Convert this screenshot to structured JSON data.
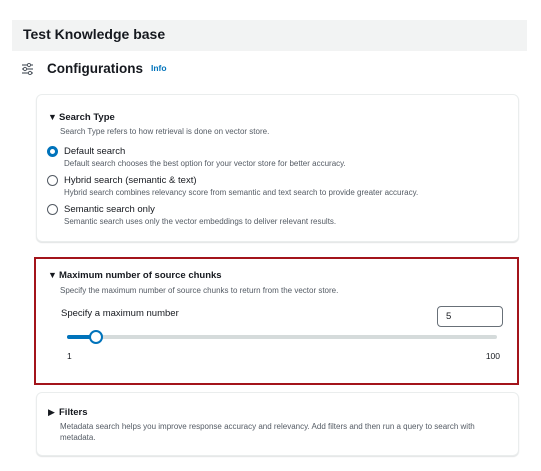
{
  "header": {
    "title": "Test Knowledge base"
  },
  "config": {
    "title": "Configurations",
    "info_label": "Info",
    "icon": "settings-sliders-icon"
  },
  "search_type": {
    "title": "Search Type",
    "description": "Search Type refers to how retrieval is done on vector store.",
    "options": [
      {
        "label": "Default search",
        "description": "Default search chooses the best option for your vector store for better accuracy.",
        "checked": true
      },
      {
        "label": "Hybrid search (semantic & text)",
        "description": "Hybrid search combines relevancy score from semantic and text search to provide greater accuracy.",
        "checked": false
      },
      {
        "label": "Semantic search only",
        "description": "Semantic search uses only the vector embeddings to deliver relevant results.",
        "checked": false
      }
    ]
  },
  "max_chunks": {
    "title": "Maximum number of source chunks",
    "description": "Specify the maximum number of source chunks to return from the vector store.",
    "field_label": "Specify a maximum number",
    "value": "5",
    "slider": {
      "min": 1,
      "max": 100,
      "min_label": "1",
      "max_label": "100",
      "value": 5
    }
  },
  "filters": {
    "title": "Filters",
    "description": "Metadata search helps you improve response accuracy and relevancy. Add filters and then run a query to search with metadata."
  },
  "colors": {
    "accent": "#0073bb",
    "highlight": "#a3141b",
    "header_bg": "#f2f3f3"
  }
}
